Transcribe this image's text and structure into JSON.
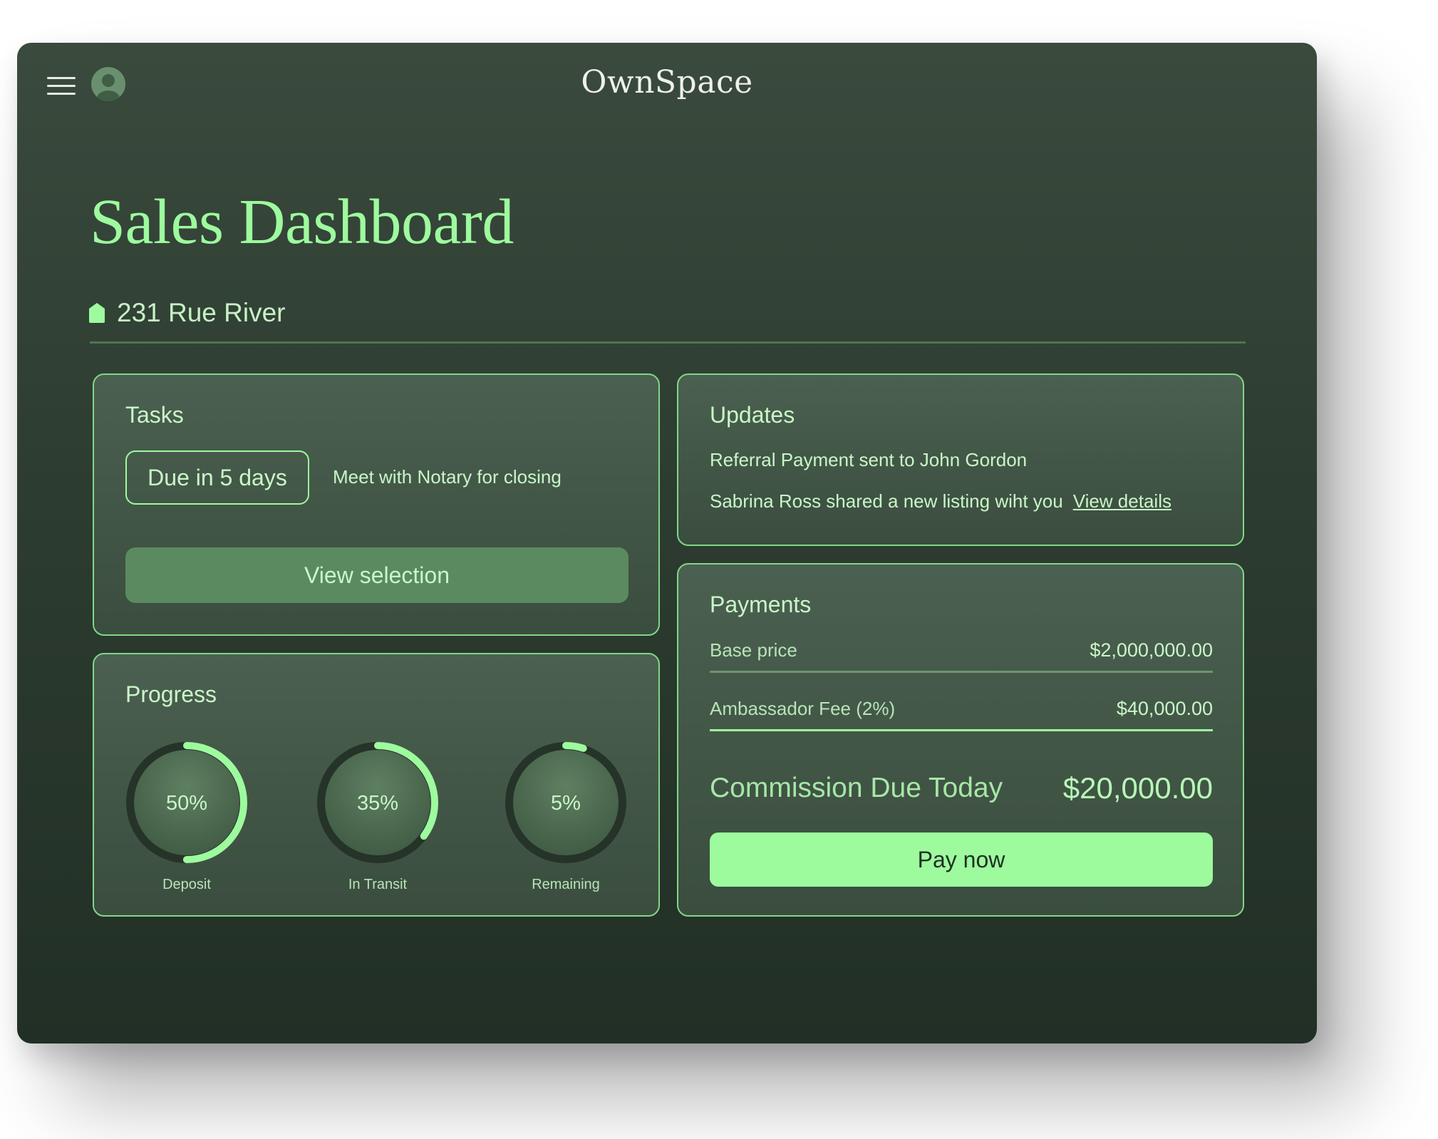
{
  "app": {
    "logo": "OwnSpace",
    "menu_icon": "hamburger-menu-icon",
    "avatar_icon": "user-avatar-icon"
  },
  "page": {
    "title": "Sales Dashboard",
    "address_icon": "home-icon",
    "address": "231 Rue River"
  },
  "tasks": {
    "title": "Tasks",
    "due_badge": "Due in 5 days",
    "task": "Meet with Notary for closing",
    "button": "View selection"
  },
  "updates": {
    "title": "Updates",
    "items": [
      {
        "text": "Referral Payment sent to John Gordon"
      },
      {
        "text": "Sabrina Ross shared a new listing wiht you",
        "link": "View details"
      }
    ]
  },
  "progress": {
    "title": "Progress",
    "rings": [
      {
        "label": "Deposit",
        "text": "50%",
        "value": 0.5
      },
      {
        "label": "In Transit",
        "text": "35%",
        "value": 0.35
      },
      {
        "label": "Remaining",
        "text": "5%",
        "value": 0.05
      }
    ]
  },
  "payments": {
    "title": "Payments",
    "rows": [
      {
        "label": "Base price",
        "amount": "$2,000,000.00"
      },
      {
        "label": "Ambassador Fee (2%)",
        "amount": "$40,000.00"
      }
    ],
    "commission_label": "Commission Due Today",
    "commission_amount": "$20,000.00",
    "button": "Pay now"
  },
  "colors": {
    "accent": "#9dfb9e",
    "background": "#2d3c30",
    "card": "#4b6050",
    "card_border": "#80d886",
    "button_muted": "#5b8a60"
  }
}
